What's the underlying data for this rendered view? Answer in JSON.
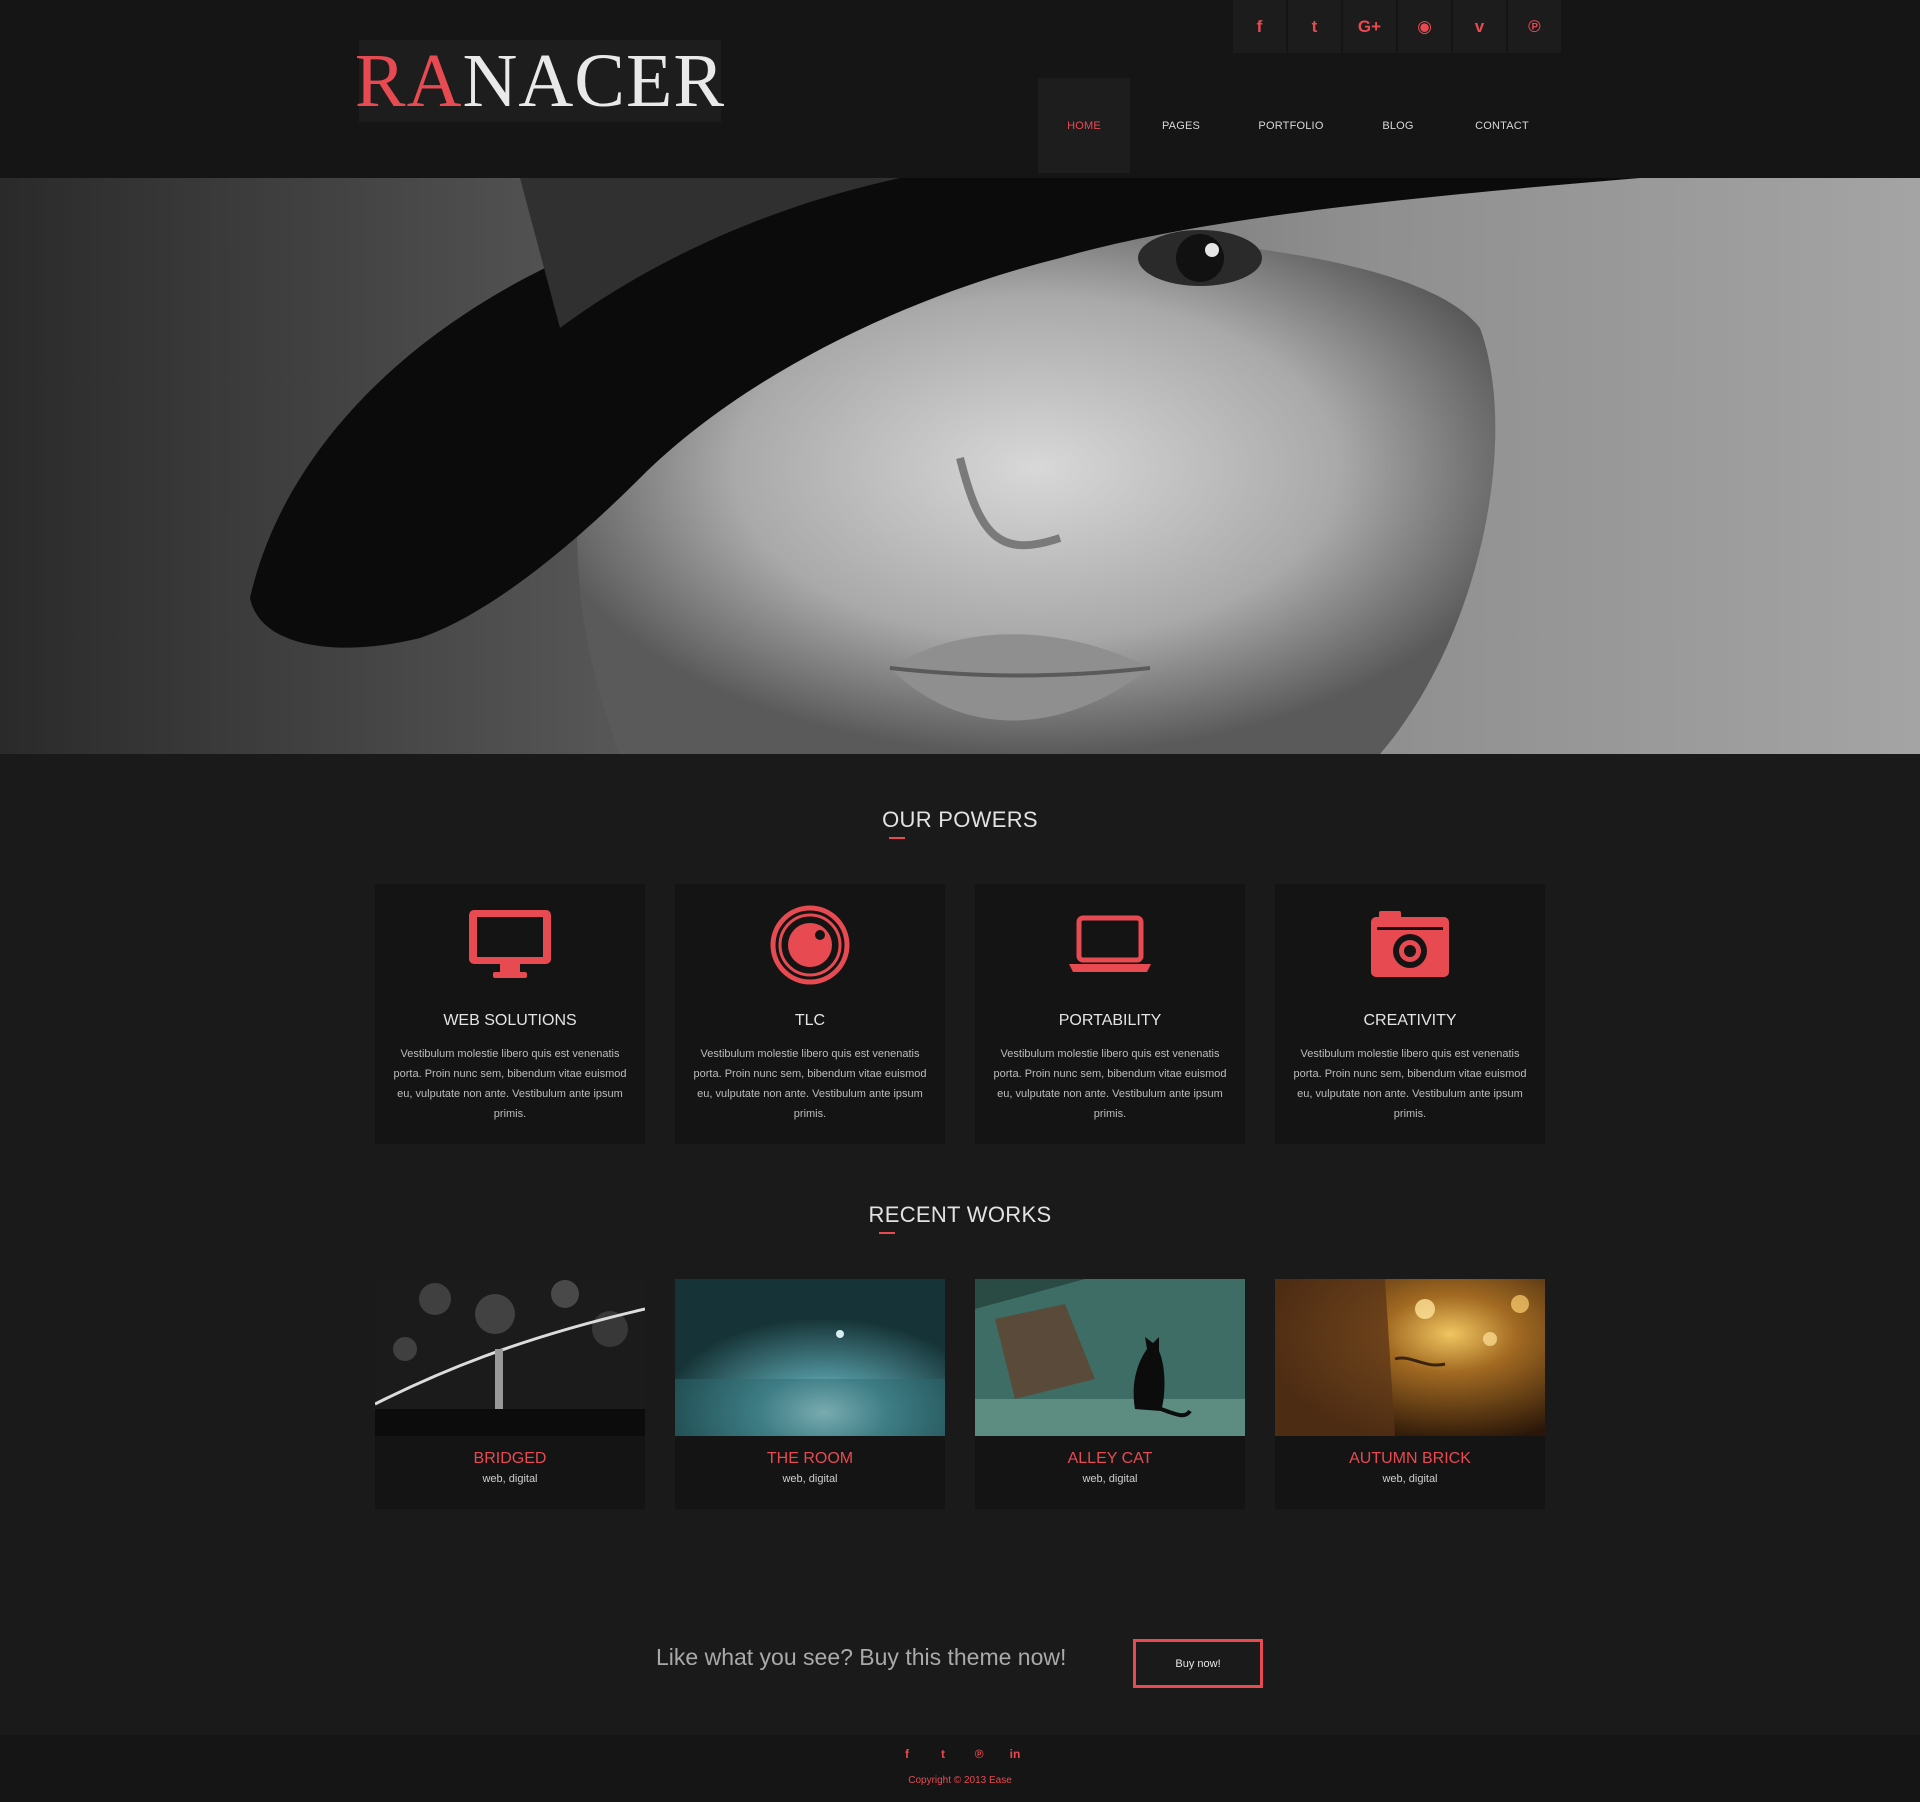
{
  "brand": {
    "logo_accent": "RA",
    "logo_rest": "NACER",
    "accent_color": "#e84a52"
  },
  "social_top": [
    {
      "icon": "facebook-icon",
      "glyph": "f"
    },
    {
      "icon": "twitter-icon",
      "glyph": "t"
    },
    {
      "icon": "google-plus-icon",
      "glyph": "G+"
    },
    {
      "icon": "rss-icon",
      "glyph": "◉"
    },
    {
      "icon": "vimeo-icon",
      "glyph": "v"
    },
    {
      "icon": "pinterest-icon",
      "glyph": "℗"
    }
  ],
  "nav": [
    {
      "label": "HOME",
      "active": true
    },
    {
      "label": "PAGES"
    },
    {
      "label": "PORTFOLIO"
    },
    {
      "label": "BLOG"
    },
    {
      "label": "CONTACT"
    }
  ],
  "powers": {
    "title": "OUR POWERS",
    "items": [
      {
        "icon": "monitor-icon",
        "title": "WEB SOLUTIONS",
        "text": "Vestibulum molestie libero quis est venenatis porta. Proin nunc sem, bibendum vitae euismod eu, vulputate non ante. Vestibulum ante ipsum primis."
      },
      {
        "icon": "lens-icon",
        "title": "TLC",
        "text": "Vestibulum molestie libero quis est venenatis porta. Proin nunc sem, bibendum vitae euismod eu, vulputate non ante. Vestibulum ante ipsum primis."
      },
      {
        "icon": "laptop-icon",
        "title": "PORTABILITY",
        "text": "Vestibulum molestie libero quis est venenatis porta. Proin nunc sem, bibendum vitae euismod eu, vulputate non ante. Vestibulum ante ipsum primis."
      },
      {
        "icon": "camera-icon",
        "title": "CREATIVITY",
        "text": "Vestibulum molestie libero quis est venenatis porta. Proin nunc sem, bibendum vitae euismod eu, vulputate non ante. Vestibulum ante ipsum primis."
      }
    ]
  },
  "works": {
    "title": "RECENT WORKS",
    "items": [
      {
        "title": "BRIDGED",
        "tags": "web, digital"
      },
      {
        "title": "THE ROOM",
        "tags": "web, digital"
      },
      {
        "title": "ALLEY CAT",
        "tags": "web, digital"
      },
      {
        "title": "AUTUMN BRICK",
        "tags": "web, digital"
      }
    ]
  },
  "cta": {
    "text": "Like what you see? Buy this theme now!",
    "button": "Buy now!"
  },
  "footer": {
    "social": [
      {
        "icon": "facebook-icon",
        "glyph": "f"
      },
      {
        "icon": "twitter-icon",
        "glyph": "t"
      },
      {
        "icon": "pinterest-icon",
        "glyph": "℗"
      },
      {
        "icon": "linkedin-icon",
        "glyph": "in"
      }
    ],
    "copyright": "Copyright © 2013 Ease"
  }
}
